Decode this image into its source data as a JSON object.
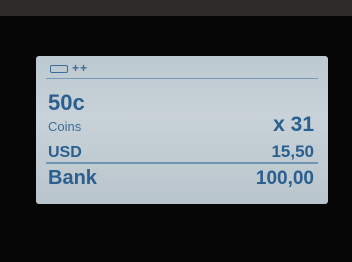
{
  "status": {
    "battery_icon": "battery-icon",
    "glyphs": "++"
  },
  "coin": {
    "denomination": "50c",
    "type_label": "Coins",
    "count_label": "x 31"
  },
  "currency": {
    "code": "USD",
    "amount": "15,50"
  },
  "bank": {
    "label": "Bank",
    "amount": "100,00"
  },
  "colors": {
    "screen_background": "#c3ced5",
    "text_blue": "#2a5f8f",
    "bezel": "#060606",
    "top_strip": "#2e2b2a"
  }
}
